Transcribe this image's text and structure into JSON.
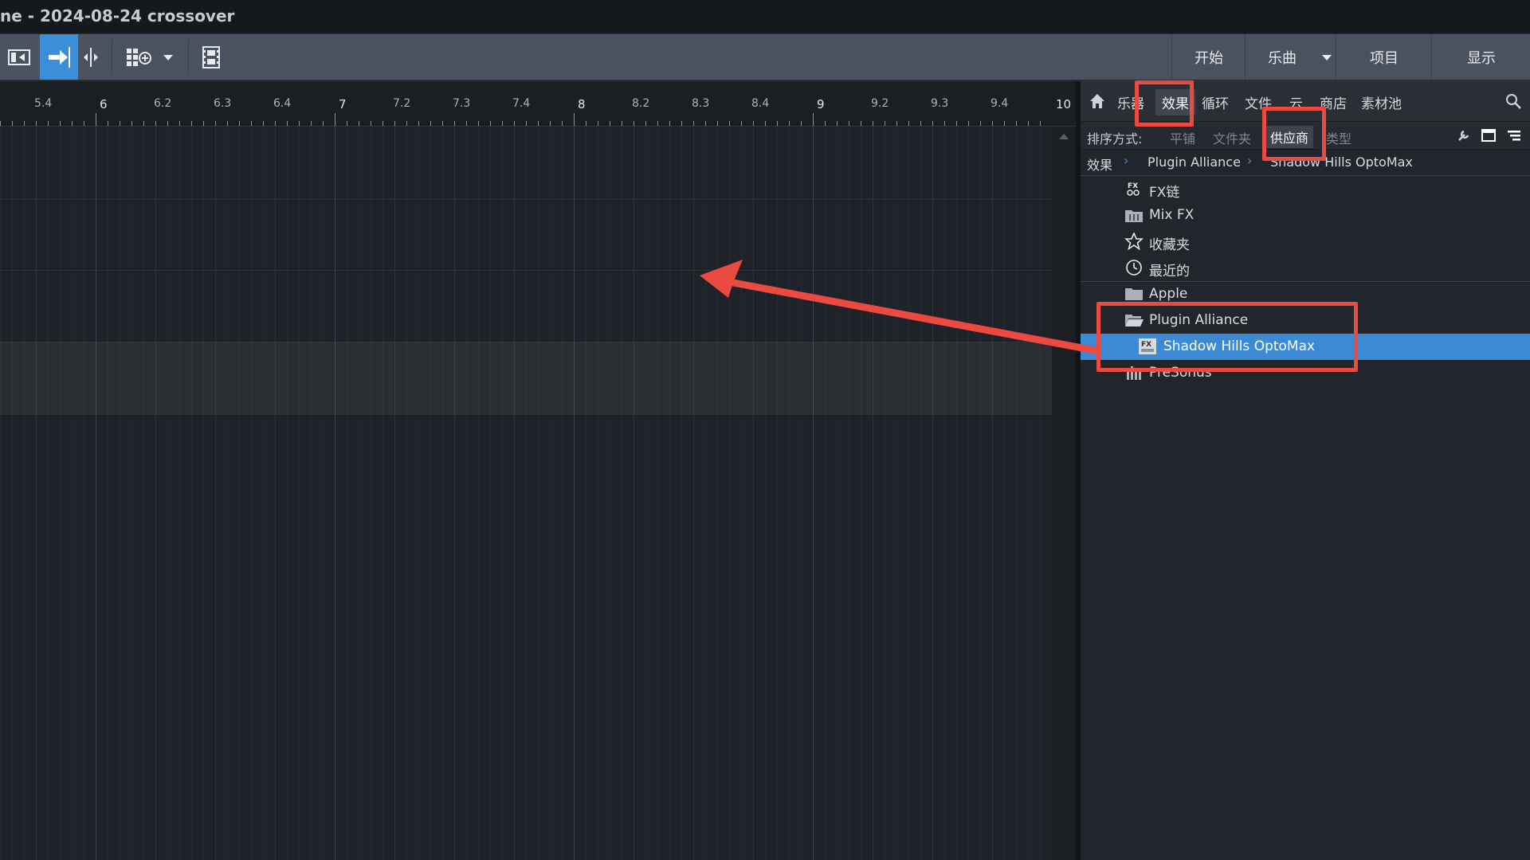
{
  "window": {
    "title": "ne - 2024-08-24 crossover"
  },
  "toolbar": {
    "tools": [
      {
        "icon": "track-list-icon"
      },
      {
        "icon": "snap-arrow-icon"
      },
      {
        "icon": "split-view-icon"
      },
      {
        "icon": "grid-add-icon"
      },
      {
        "icon": "dropdown-arrow-icon"
      },
      {
        "icon": "film-strip-icon"
      }
    ],
    "nav": [
      "开始",
      "乐曲",
      "项目",
      "显示"
    ]
  },
  "ruler": {
    "labels": [
      "5.4",
      "6",
      "6.2",
      "6.3",
      "6.4",
      "7",
      "7.2",
      "7.3",
      "7.4",
      "8",
      "8.2",
      "8.3",
      "8.4",
      "9",
      "9.2",
      "9.3",
      "9.4",
      "10"
    ]
  },
  "browser": {
    "tabs": [
      "乐器",
      "效果",
      "循环",
      "文件",
      "云",
      "商店",
      "素材池"
    ],
    "active_tab": "效果",
    "sort_label": "排序方式:",
    "sort_options": [
      "平铺",
      "文件夹",
      "供应商",
      "类型"
    ],
    "active_sort": "供应商",
    "breadcrumb": [
      "效果",
      "Plugin Alliance",
      "Shadow Hills OptoMax"
    ],
    "tree": [
      {
        "label": "FX链",
        "icon": "fx-chain-icon",
        "expanded": false
      },
      {
        "label": "Mix FX",
        "icon": "mix-fx-icon",
        "expanded": false
      },
      {
        "label": "收藏夹",
        "icon": "star-icon",
        "expanded": false
      },
      {
        "label": "最近的",
        "icon": "clock-icon",
        "expanded": false
      },
      {
        "label": "Apple",
        "icon": "folder-icon",
        "expanded": false
      },
      {
        "label": "Plugin Alliance",
        "icon": "folder-open-icon",
        "expanded": true
      },
      {
        "label": "Shadow Hills OptoMax",
        "icon": "fx-plugin-icon",
        "selected": true
      },
      {
        "label": "PreSonus",
        "icon": "presonus-icon",
        "expanded": false
      }
    ]
  },
  "colors": {
    "selection": "#3c8ad4",
    "annotation": "#ea4a3f",
    "toolbar_active": "#3a8fd8"
  }
}
